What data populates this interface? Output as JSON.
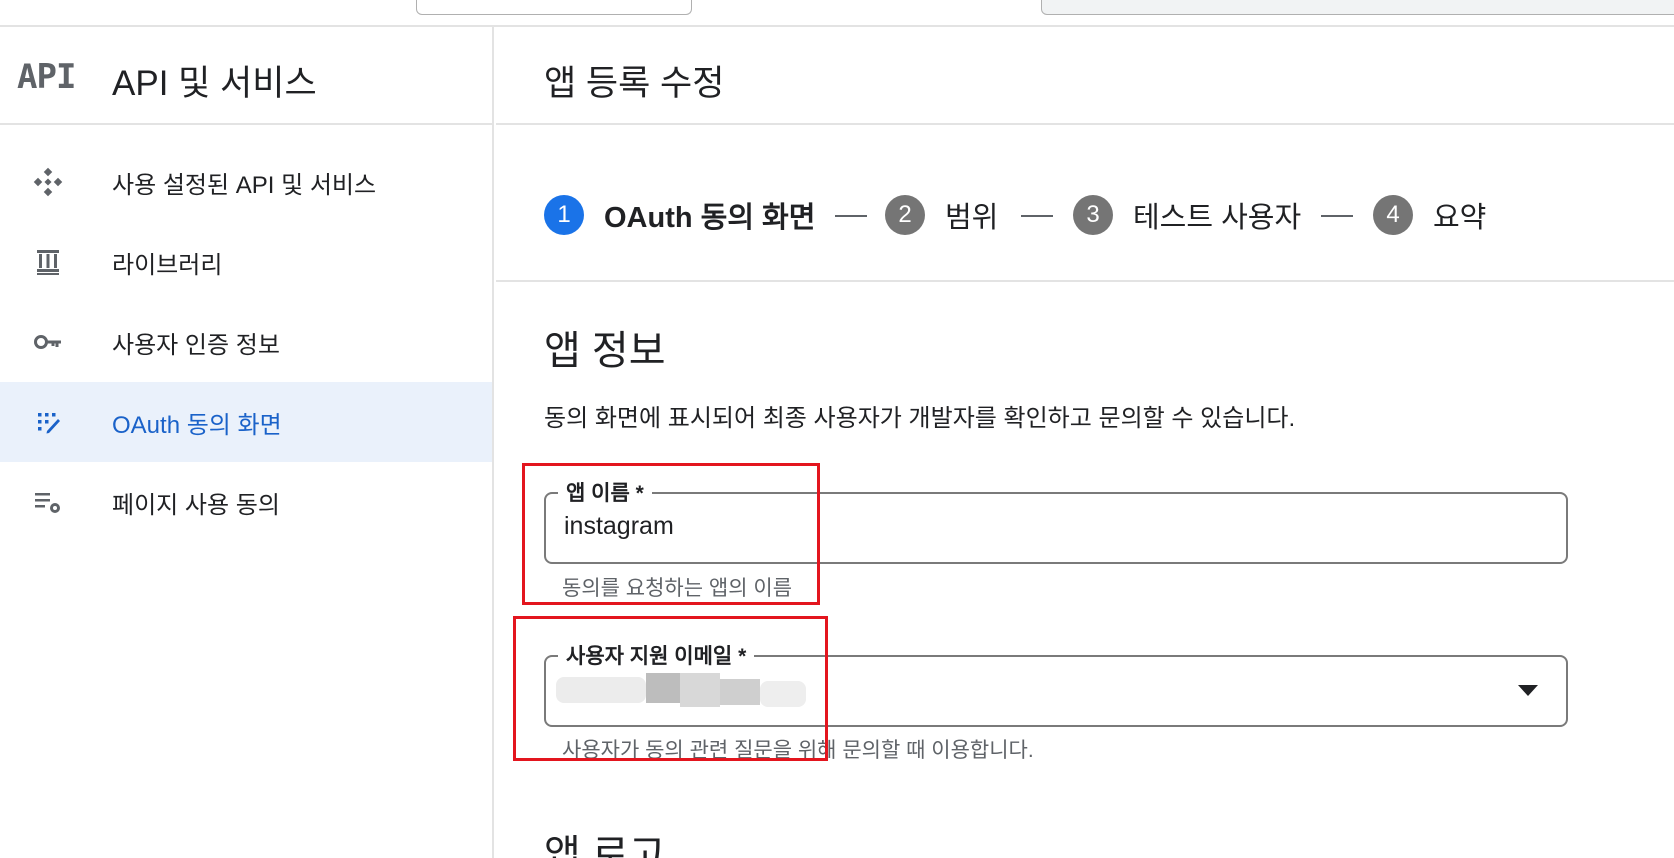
{
  "sidebar": {
    "logo_text": "API",
    "title": "API 및 서비스",
    "items": [
      {
        "label": "사용 설정된 API 및 서비스",
        "icon": "api-diamond-icon",
        "active": false
      },
      {
        "label": "라이브러리",
        "icon": "library-icon",
        "active": false
      },
      {
        "label": "사용자 인증 정보",
        "icon": "key-icon",
        "active": false
      },
      {
        "label": "OAuth 동의 화면",
        "icon": "oauth-consent-icon",
        "active": true
      },
      {
        "label": "페이지 사용 동의",
        "icon": "settings-list-icon",
        "active": false
      }
    ]
  },
  "main": {
    "title": "앱 등록 수정",
    "steps": [
      {
        "number": "1",
        "label": "OAuth 동의 화면",
        "active": true
      },
      {
        "number": "2",
        "label": "범위",
        "active": false
      },
      {
        "number": "3",
        "label": "테스트 사용자",
        "active": false
      },
      {
        "number": "4",
        "label": "요약",
        "active": false
      }
    ],
    "app_info": {
      "title": "앱 정보",
      "description": "동의 화면에 표시되어 최종 사용자가 개발자를 확인하고 문의할 수 있습니다.",
      "app_name": {
        "label": "앱 이름 *",
        "value": "instagram",
        "hint": "동의를 요청하는 앱의 이름"
      },
      "support_email": {
        "label": "사용자 지원 이메일 *",
        "hint": "사용자가 동의 관련 질문을 위해 문의할 때 이용합니다."
      }
    },
    "app_logo": {
      "title": "앱 로고"
    }
  },
  "colors": {
    "accent": "#1a73e8",
    "active_nav_bg": "#eaf1fb",
    "active_nav_text": "#1a62c9",
    "highlight": "#e3151e",
    "inactive_step": "#757575"
  }
}
